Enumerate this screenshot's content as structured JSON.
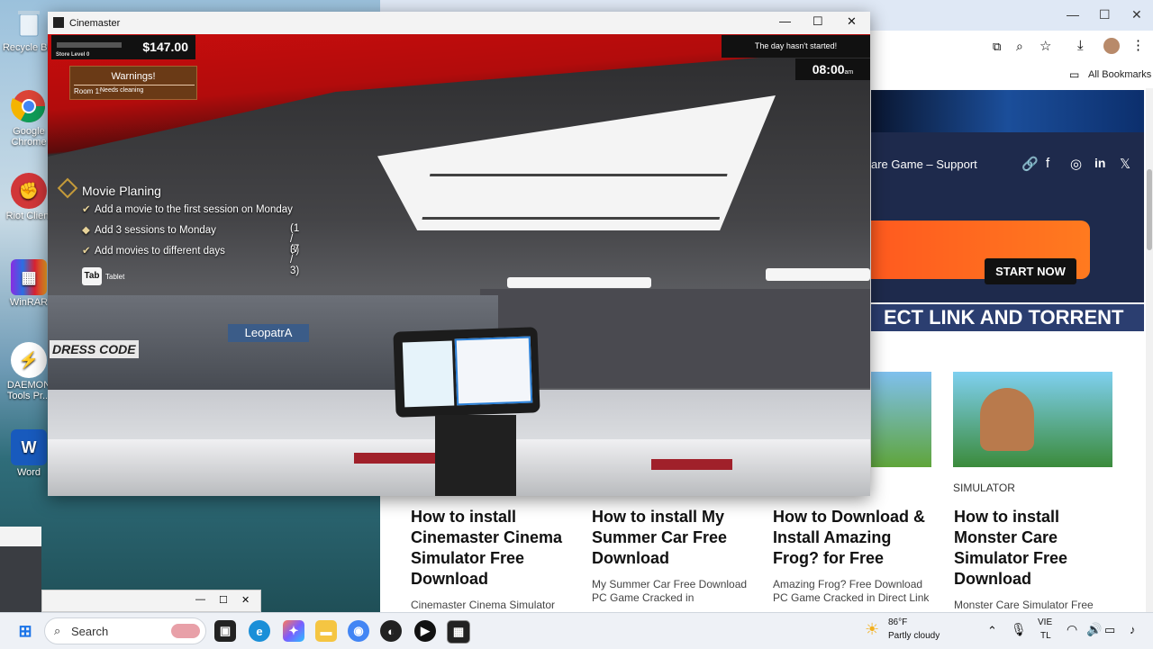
{
  "desktop": {
    "icons": [
      {
        "label": "Recycle Bin",
        "color": "#7aa7c7"
      },
      {
        "label": "Google Chrome",
        "color": "#4285f4"
      },
      {
        "label": "Riot Client",
        "color": "#d13639"
      },
      {
        "label": "WinRAR",
        "color": "#8a2be2"
      },
      {
        "label": "DAEMON Tools Pr...",
        "color": "#f39c12"
      },
      {
        "label": "Word",
        "color": "#185abd"
      }
    ]
  },
  "game": {
    "title": "Cinemaster",
    "money": "$147.00",
    "store_level": "Store Level 0",
    "warnings_title": "Warnings!",
    "warning_room": "Room 1:",
    "warning_message": "Needs cleaning",
    "day_status": "The day hasn't started!",
    "clock": "08:00",
    "clock_suffix": "am",
    "quest_title": "Movie Planing",
    "quest_items": [
      {
        "text": "Add a movie to the first session on Monday",
        "progress": ""
      },
      {
        "text": "Add 3 sessions to Monday",
        "progress": "(1 / 3)"
      },
      {
        "text": "Add movies to different days",
        "progress": "(7 / 3)"
      }
    ],
    "tab_key": "Tab",
    "tab_label": "Tablet",
    "store_sign_left": "DRESS CODE",
    "store_sign_right": "LeopatrA"
  },
  "browser": {
    "bookmarks_label": "All Bookmarks",
    "nav_text": "are Game – Support",
    "start_button": "START NOW",
    "strip_text": "ECT LINK AND TORRENT",
    "cards": [
      {
        "category": "",
        "title": "How to install Cinemaster Cinema Simulator Free Download",
        "desc": "Cinemaster Cinema Simulator"
      },
      {
        "category": "",
        "title": "How to install My Summer Car Free Download",
        "desc": "My Summer Car Free Download PC Game Cracked in"
      },
      {
        "category": "",
        "title": "How to Download & Install Amazing Frog? for Free",
        "desc": "Amazing Frog? Free Download PC Game Cracked in Direct Link"
      },
      {
        "category": "SIMULATOR",
        "title": "How to install Monster Care Simulator Free Download",
        "desc": "Monster Care Simulator Free"
      }
    ]
  },
  "taskbar": {
    "search_placeholder": "Search",
    "weather_temp": "86°F",
    "weather_desc": "Partly cloudy",
    "lang_1": "VIE",
    "lang_2": "TL"
  }
}
